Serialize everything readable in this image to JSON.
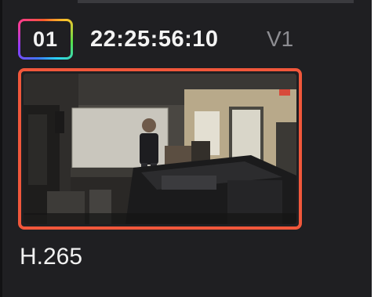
{
  "clip": {
    "number": "01",
    "timecode": "22:25:56:10",
    "track": "V1",
    "codec": "H.265"
  },
  "colors": {
    "card_background": "#1f1f22",
    "selection_border": "#f1573b",
    "primary_text": "#f3f3f3",
    "secondary_text": "#8d8d92"
  },
  "thumbnail": {
    "icon": "video-frame-thumbnail",
    "selected": true
  }
}
